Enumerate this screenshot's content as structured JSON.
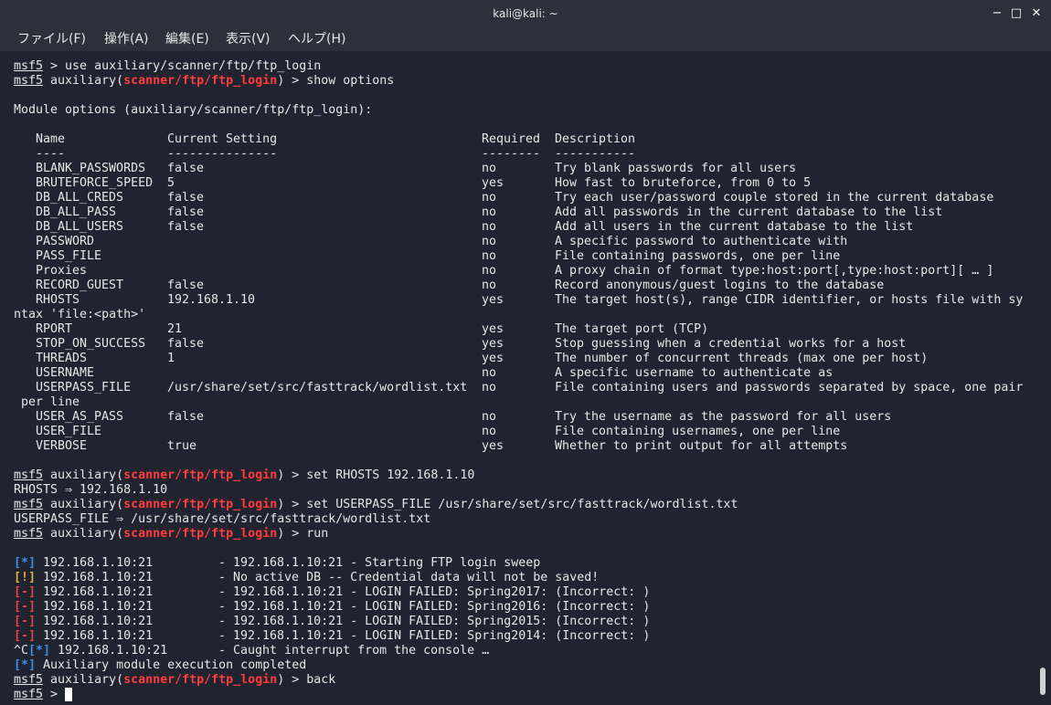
{
  "window": {
    "title": "kali@kali: ~",
    "minimize_glyph": "−",
    "maximize_glyph": "□",
    "close_glyph": "✕"
  },
  "menu": [
    "ファイル(F)",
    "操作(A)",
    "編集(E)",
    "表示(V)",
    "ヘルプ(H)"
  ],
  "prompt": {
    "msf": "msf5",
    "aux_prefix": " auxiliary(",
    "module": "scanner/ftp/ftp_login",
    "aux_suffix": ") > "
  },
  "commands": {
    "use": " > use auxiliary/scanner/ftp/ftp_login",
    "show": "show options",
    "set_rhosts": "set RHOSTS 192.168.1.10",
    "set_userpass": "set USERPASS_FILE /usr/share/set/src/fasttrack/wordlist.txt",
    "run": "run",
    "back": "back",
    "final": " > "
  },
  "outputs": {
    "module_options": "Module options (auxiliary/scanner/ftp/ftp_login):",
    "rhosts_set": "RHOSTS ⇒ 192.168.1.10",
    "userpass_set": "USERPASS_FILE ⇒ /usr/share/set/src/fasttrack/wordlist.txt"
  },
  "table": {
    "headers": [
      "Name",
      "Current Setting",
      "Required",
      "Description"
    ],
    "underlines": [
      "----",
      "---------------",
      "--------",
      "-----------"
    ],
    "rows": [
      {
        "name": "BLANK_PASSWORDS",
        "setting": "false",
        "required": "no",
        "desc": "Try blank passwords for all users"
      },
      {
        "name": "BRUTEFORCE_SPEED",
        "setting": "5",
        "required": "yes",
        "desc": "How fast to bruteforce, from 0 to 5"
      },
      {
        "name": "DB_ALL_CREDS",
        "setting": "false",
        "required": "no",
        "desc": "Try each user/password couple stored in the current database"
      },
      {
        "name": "DB_ALL_PASS",
        "setting": "false",
        "required": "no",
        "desc": "Add all passwords in the current database to the list"
      },
      {
        "name": "DB_ALL_USERS",
        "setting": "false",
        "required": "no",
        "desc": "Add all users in the current database to the list"
      },
      {
        "name": "PASSWORD",
        "setting": "",
        "required": "no",
        "desc": "A specific password to authenticate with"
      },
      {
        "name": "PASS_FILE",
        "setting": "",
        "required": "no",
        "desc": "File containing passwords, one per line"
      },
      {
        "name": "Proxies",
        "setting": "",
        "required": "no",
        "desc": "A proxy chain of format type:host:port[,type:host:port][ … ]"
      },
      {
        "name": "RECORD_GUEST",
        "setting": "false",
        "required": "no",
        "desc": "Record anonymous/guest logins to the database"
      },
      {
        "name": "RHOSTS",
        "setting": "192.168.1.10",
        "required": "yes",
        "desc": "The target host(s), range CIDR identifier, or hosts file with sy"
      },
      {
        "wrap": "ntax 'file:<path>'"
      },
      {
        "name": "RPORT",
        "setting": "21",
        "required": "yes",
        "desc": "The target port (TCP)"
      },
      {
        "name": "STOP_ON_SUCCESS",
        "setting": "false",
        "required": "yes",
        "desc": "Stop guessing when a credential works for a host"
      },
      {
        "name": "THREADS",
        "setting": "1",
        "required": "yes",
        "desc": "The number of concurrent threads (max one per host)"
      },
      {
        "name": "USERNAME",
        "setting": "",
        "required": "no",
        "desc": "A specific username to authenticate as"
      },
      {
        "name": "USERPASS_FILE",
        "setting": "/usr/share/set/src/fasttrack/wordlist.txt",
        "required": "no",
        "desc": "File containing users and passwords separated by space, one pair"
      },
      {
        "wrap": " per line"
      },
      {
        "name": "USER_AS_PASS",
        "setting": "false",
        "required": "no",
        "desc": "Try the username as the password for all users"
      },
      {
        "name": "USER_FILE",
        "setting": "",
        "required": "no",
        "desc": "File containing usernames, one per line"
      },
      {
        "name": "VERBOSE",
        "setting": "true",
        "required": "yes",
        "desc": "Whether to print output for all attempts"
      }
    ]
  },
  "run_output": [
    {
      "prefix": "",
      "tag": "[*]",
      "color": "blue",
      "host": " 192.168.1.10:21",
      "msg": "- 192.168.1.10:21 - Starting FTP login sweep"
    },
    {
      "prefix": "",
      "tag": "[!]",
      "color": "yellow",
      "host": " 192.168.1.10:21",
      "msg": "- No active DB -- Credential data will not be saved!"
    },
    {
      "prefix": "",
      "tag": "[-]",
      "color": "red",
      "host": " 192.168.1.10:21",
      "msg": "- 192.168.1.10:21 - LOGIN FAILED: Spring2017: (Incorrect: )"
    },
    {
      "prefix": "",
      "tag": "[-]",
      "color": "red",
      "host": " 192.168.1.10:21",
      "msg": "- 192.168.1.10:21 - LOGIN FAILED: Spring2016: (Incorrect: )"
    },
    {
      "prefix": "",
      "tag": "[-]",
      "color": "red",
      "host": " 192.168.1.10:21",
      "msg": "- 192.168.1.10:21 - LOGIN FAILED: Spring2015: (Incorrect: )"
    },
    {
      "prefix": "",
      "tag": "[-]",
      "color": "red",
      "host": " 192.168.1.10:21",
      "msg": "- 192.168.1.10:21 - LOGIN FAILED: Spring2014: (Incorrect: )"
    },
    {
      "prefix": "^C",
      "tag": "[*]",
      "color": "blue",
      "host": " 192.168.1.10:21",
      "msg": "- Caught interrupt from the console …"
    }
  ],
  "completed": {
    "tag": "[*]",
    "text": " Auxiliary module execution completed"
  },
  "colors": {
    "background": "#1f2430",
    "titlebar": "#2b303b",
    "module": "#ff3b3b",
    "blue": "#3b8eea",
    "yellow": "#e5b23a",
    "red": "#e64545"
  },
  "icons": {
    "minimize": "minimize-icon",
    "maximize": "maximize-icon",
    "close": "close-icon"
  }
}
